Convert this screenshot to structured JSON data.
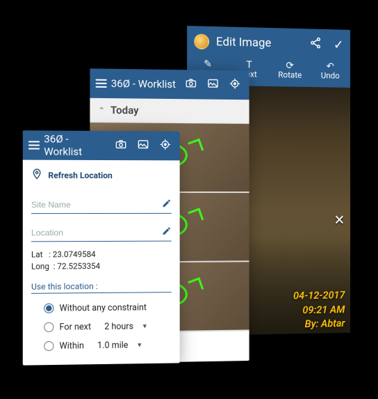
{
  "brand": "36Ø",
  "appTitle": "Worklist",
  "headerTitleCombined": "36Ø - Worklist",
  "editImage": {
    "title": "Edit Image",
    "tabs": {
      "draw": "Draw",
      "text": "Text",
      "rotate": "Rotate",
      "undo": "Undo"
    },
    "stamp": {
      "date": "04-12-2017",
      "time": "09:21 AM",
      "by": "By: Abtar"
    }
  },
  "worklistB": {
    "todayLabel": "Today"
  },
  "form": {
    "refreshLabel": "Refresh Location",
    "siteNamePlaceholder": "Site Name",
    "locationPlaceholder": "Location",
    "latLabel": "Lat",
    "latValue": "23.0749584",
    "longLabel": "Long",
    "longValue": "72.5253354",
    "useThisLocation": "Use this location :",
    "opt1": "Without any constraint",
    "opt2Prefix": "For next",
    "opt2Value": "2 hours",
    "opt3Prefix": "Within",
    "opt3Value": "1.0 mile"
  }
}
